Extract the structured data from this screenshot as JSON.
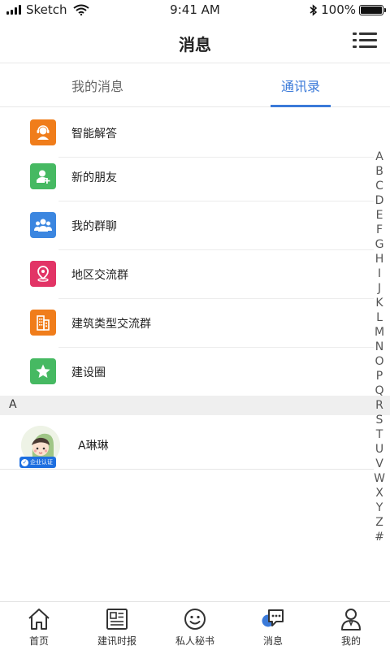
{
  "status_bar": {
    "carrier": "Sketch",
    "time": "9:41 AM",
    "battery": "100%",
    "battery_level": 1.0
  },
  "header": {
    "title": "消息",
    "menu_icon": "hamburger-menu-icon"
  },
  "tabs": [
    {
      "label": "我的消息",
      "active": false
    },
    {
      "label": "通讯录",
      "active": true
    }
  ],
  "entries": [
    {
      "label": "智能解答",
      "icon": "headset-user-icon",
      "color": "#f07d1b"
    },
    {
      "label": "新的朋友",
      "icon": "add-user-icon",
      "color": "#46b962"
    },
    {
      "label": "我的群聊",
      "icon": "group-icon",
      "color": "#3b86e0"
    },
    {
      "label": "地区交流群",
      "icon": "location-pin-icon",
      "color": "#e23466"
    },
    {
      "label": "建筑类型交流群",
      "icon": "building-icon",
      "color": "#f07d1b"
    },
    {
      "label": "建设圈",
      "icon": "star-icon",
      "color": "#46b962"
    }
  ],
  "section": {
    "letter": "A"
  },
  "contacts": [
    {
      "name": "A琳琳",
      "badge": "企业认证"
    }
  ],
  "index_letters": [
    "A",
    "B",
    "C",
    "D",
    "E",
    "F",
    "G",
    "H",
    "I",
    "J",
    "K",
    "L",
    "M",
    "N",
    "O",
    "P",
    "Q",
    "R",
    "S",
    "T",
    "U",
    "V",
    "W",
    "X",
    "Y",
    "Z",
    "#"
  ],
  "bottom_nav": [
    {
      "label": "首页",
      "icon": "home-icon"
    },
    {
      "label": "建讯时报",
      "icon": "newspaper-icon"
    },
    {
      "label": "私人秘书",
      "icon": "smiley-icon"
    },
    {
      "label": "消息",
      "icon": "message-icon"
    },
    {
      "label": "我的",
      "icon": "user-icon"
    }
  ],
  "colors": {
    "accent": "#3b7ad9",
    "text": "#222222"
  }
}
